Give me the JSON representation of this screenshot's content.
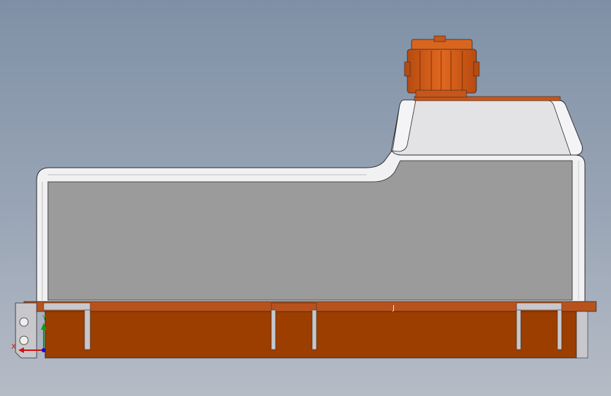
{
  "viewport": {
    "background_top": "#7f90a6",
    "background_bottom": "#b6bcc6"
  },
  "colors": {
    "housing_front": "#9a9a9a",
    "housing_highlight": "#f2f2f4",
    "housing_top_face": "#e3e3e6",
    "edge": "#2a2a2a",
    "mount_plate": "#9b3e00",
    "mount_plate_light": "#c2612a",
    "connector_orange": "#d15a17",
    "connector_dark": "#8a3300",
    "bracket_gray": "#c8c8cc"
  },
  "triad": {
    "x_label": "X",
    "y_label": "Y",
    "x_color": "#d01010",
    "y_color": "#10a010",
    "z_color": "#1010d0"
  },
  "annotations": {
    "small_mark": "J"
  },
  "icons": {
    "connector": "connector-icon",
    "triad": "coordinate-triad-icon"
  }
}
